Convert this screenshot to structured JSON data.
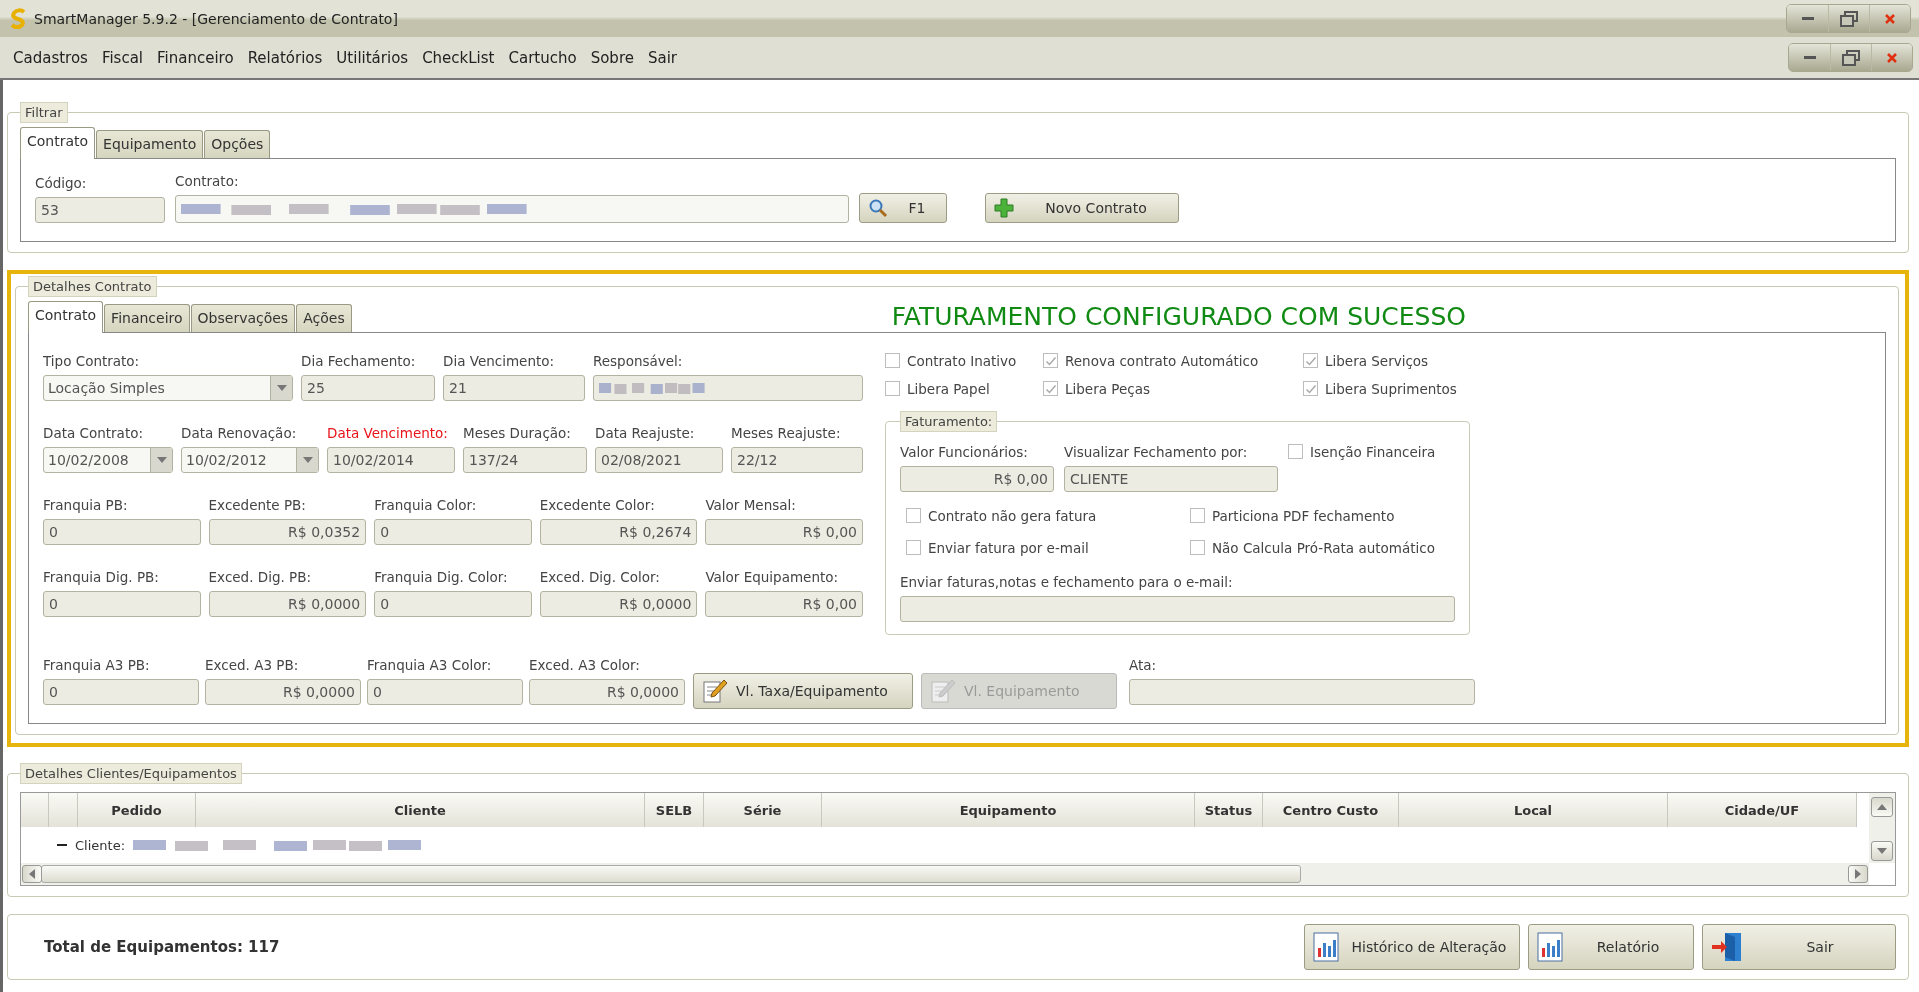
{
  "window": {
    "title": "SmartManager 5.9.2 - [Gerenciamento de Contrato]"
  },
  "menu": [
    "Cadastros",
    "Fiscal",
    "Financeiro",
    "Relatórios",
    "Utilitários",
    "CheckList",
    "Cartucho",
    "Sobre",
    "Sair"
  ],
  "filter": {
    "legend": "Filtrar",
    "tabs": [
      {
        "label": "Contrato",
        "selected": true
      },
      {
        "label": "Equipamento",
        "selected": false
      },
      {
        "label": "Opções",
        "selected": false
      }
    ],
    "codigo": {
      "label": "Código:",
      "value": "53"
    },
    "contrato": {
      "label": "Contrato:",
      "blurred": true
    },
    "buttons": [
      {
        "label": "F1",
        "kind": "search"
      },
      {
        "label": "Novo Contrato",
        "kind": "add"
      }
    ]
  },
  "details": {
    "legend": "Detalhes Contrato",
    "tabs": [
      {
        "label": "Contrato",
        "selected": true
      },
      {
        "label": "Financeiro",
        "selected": false
      },
      {
        "label": "Observações",
        "selected": false
      },
      {
        "label": "Ações",
        "selected": false
      }
    ],
    "message": "FATURAMENTO CONFIGURADO COM SUCESSO",
    "rows": [
      {
        "fields": [
          {
            "label": "Tipo Contrato:",
            "value": "Locação Simples",
            "kind": "combo"
          },
          {
            "label": "Dia Fechamento:",
            "value": "25",
            "kind": "text"
          },
          {
            "label": "Dia Vencimento:",
            "value": "21",
            "kind": "text"
          },
          {
            "label": "Responsável:",
            "kind": "blurred"
          }
        ]
      },
      {
        "fields": [
          {
            "label": "Data Contrato:",
            "value": "10/02/2008",
            "kind": "combo"
          },
          {
            "label": "Data Renovação:",
            "value": "10/02/2012",
            "kind": "combo"
          },
          {
            "label": "Data Vencimento:",
            "value": "10/02/2014",
            "kind": "text",
            "alert": true
          },
          {
            "label": "Meses Duração:",
            "value": "137/24",
            "kind": "text"
          },
          {
            "label": "Data Reajuste:",
            "value": "02/08/2021",
            "kind": "text"
          },
          {
            "label": "Meses Reajuste:",
            "value": "22/12",
            "kind": "text"
          }
        ]
      },
      {
        "fields": [
          {
            "label": "Franquia PB:",
            "value": "0",
            "kind": "text"
          },
          {
            "label": "Excedente PB:",
            "value": "R$ 0,0352",
            "kind": "money"
          },
          {
            "label": "Franquia Color:",
            "value": "0",
            "kind": "text"
          },
          {
            "label": "Excedente Color:",
            "value": "R$ 0,2674",
            "kind": "money"
          },
          {
            "label": "Valor Mensal:",
            "value": "R$ 0,00",
            "kind": "money"
          }
        ]
      },
      {
        "fields": [
          {
            "label": "Franquia Dig. PB:",
            "value": "0",
            "kind": "text"
          },
          {
            "label": "Exced. Dig. PB:",
            "value": "R$ 0,0000",
            "kind": "money"
          },
          {
            "label": "Franquia Dig. Color:",
            "value": "0",
            "kind": "text"
          },
          {
            "label": "Exced. Dig. Color:",
            "value": "R$ 0,0000",
            "kind": "money"
          },
          {
            "label": "Valor Equipamento:",
            "value": "R$ 0,00",
            "kind": "money"
          }
        ]
      }
    ],
    "a3_row": [
      {
        "label": "Franquia A3 PB:",
        "value": "0",
        "kind": "text"
      },
      {
        "label": "Exced. A3 PB:",
        "value": "R$ 0,0000",
        "kind": "money"
      },
      {
        "label": "Franquia A3 Color:",
        "value": "0",
        "kind": "text"
      },
      {
        "label": "Exced. A3 Color:",
        "value": "R$ 0,0000",
        "kind": "money"
      }
    ],
    "flags": [
      {
        "label": "Contrato Inativo",
        "checked": false
      },
      {
        "label": "Renova contrato Automático",
        "checked": true
      },
      {
        "label": "Libera Serviços",
        "checked": true
      },
      {
        "label": "Libera Papel",
        "checked": false
      },
      {
        "label": "Libera Peças",
        "checked": true
      },
      {
        "label": "Libera Suprimentos",
        "checked": true
      }
    ],
    "billing": {
      "legend": "Faturamento:",
      "valor": {
        "label": "Valor Funcionários:",
        "value": "R$ 0,00"
      },
      "visualizar": {
        "label": "Visualizar Fechamento por:",
        "value": "CLIENTE"
      },
      "isencao": {
        "label": "Isenção Financeira",
        "checked": false
      },
      "options": [
        {
          "label": "Contrato não gera fatura",
          "checked": false
        },
        {
          "label": "Particiona PDF fechamento",
          "checked": false
        },
        {
          "label": "Enviar fatura por e-mail",
          "checked": false
        },
        {
          "label": "Não Calcula Pró-Rata automático",
          "checked": false
        }
      ],
      "email": {
        "label": "Enviar faturas,notas e fechamento para o e-mail:"
      }
    },
    "actions": [
      {
        "label": "Vl. Taxa/Equipamento",
        "disabled": false
      },
      {
        "label": "Vl. Equipamento",
        "disabled": true
      }
    ],
    "ata": {
      "label": "Ata:"
    }
  },
  "clients": {
    "legend": "Detalhes Clientes/Equipamentos",
    "columns": [
      "Pedido",
      "Cliente",
      "SELB",
      "Série",
      "Equipamento",
      "Status",
      "Centro Custo",
      "Local",
      "Cidade/UF"
    ],
    "group": {
      "label": "Cliente:",
      "expanded": true,
      "blurred": true
    }
  },
  "footer": {
    "total": "Total de Equipamentos: 117",
    "buttons": [
      {
        "label": "Histórico de Alteração",
        "kind": "report"
      },
      {
        "label": "Relatório",
        "kind": "report"
      },
      {
        "label": "Sair",
        "kind": "exit"
      }
    ]
  }
}
